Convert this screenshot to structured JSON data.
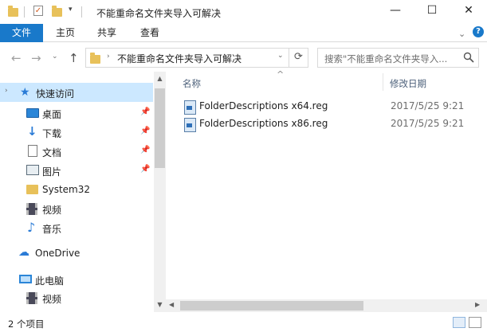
{
  "window": {
    "title": "不能重命名文件夹导入可解决",
    "controls": [
      "—",
      "☐",
      "✕"
    ]
  },
  "ribbon": {
    "tabs": [
      "文件",
      "主页",
      "共享",
      "查看"
    ]
  },
  "address": {
    "path": "不能重命名文件夹导入可解决"
  },
  "search": {
    "placeholder": "搜索\"不能重命名文件夹导入..."
  },
  "nav": {
    "quick_access": "快速访问",
    "items": [
      {
        "label": "桌面",
        "icon": "desktop-icon",
        "pinned": true
      },
      {
        "label": "下载",
        "icon": "download-icon",
        "pinned": true
      },
      {
        "label": "文档",
        "icon": "document-icon",
        "pinned": true
      },
      {
        "label": "图片",
        "icon": "pictures-icon",
        "pinned": true
      },
      {
        "label": "System32",
        "icon": "folder-icon",
        "pinned": false
      },
      {
        "label": "视频",
        "icon": "video-icon",
        "pinned": false
      },
      {
        "label": "音乐",
        "icon": "music-icon",
        "pinned": false
      }
    ],
    "onedrive": "OneDrive",
    "this_pc": "此电脑",
    "pc_items": [
      {
        "label": "视频",
        "icon": "video-icon"
      }
    ]
  },
  "columns": {
    "name": "名称",
    "date": "修改日期"
  },
  "files": [
    {
      "name": "FolderDescriptions x64.reg",
      "date": "2017/5/25 9:21"
    },
    {
      "name": "FolderDescriptions x86.reg",
      "date": "2017/5/25 9:21"
    }
  ],
  "status": {
    "count": "2 个项目"
  },
  "colors": {
    "accent": "#1979ca",
    "selection": "#cce8ff"
  }
}
